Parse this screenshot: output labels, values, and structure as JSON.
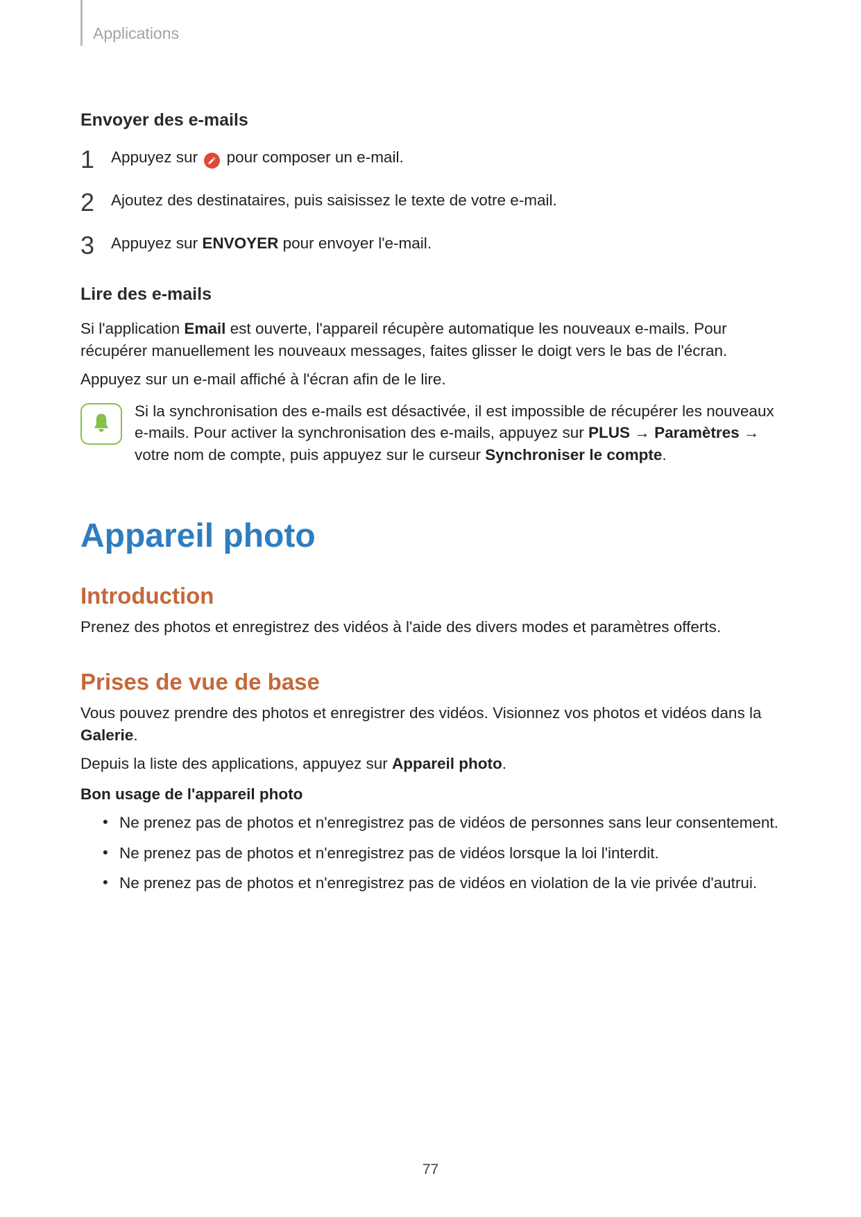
{
  "header": {
    "section": "Applications"
  },
  "email": {
    "send_heading": "Envoyer des e-mails",
    "step1_pre": "Appuyez sur ",
    "step1_post": " pour composer un e-mail.",
    "step2": "Ajoutez des destinataires, puis saisissez le texte de votre e-mail.",
    "step3_pre": "Appuyez sur ",
    "step3_bold": "ENVOYER",
    "step3_post": " pour envoyer l'e-mail.",
    "read_heading": "Lire des e-mails",
    "read_p1_pre": "Si l'application ",
    "read_p1_bold": "Email",
    "read_p1_post": " est ouverte, l'appareil récupère automatique les nouveaux e-mails. Pour récupérer manuellement les nouveaux messages, faites glisser le doigt vers le bas de l'écran.",
    "read_p2": "Appuyez sur un e-mail affiché à l'écran afin de le lire.",
    "note_pre": "Si la synchronisation des e-mails est désactivée, il est impossible de récupérer les nouveaux e-mails. Pour activer la synchronisation des e-mails, appuyez sur ",
    "note_b1": "PLUS",
    "note_arrow": " → ",
    "note_b2": "Paramètres",
    "note_mid": "votre nom de compte, puis appuyez sur le curseur ",
    "note_b3": "Synchroniser le compte",
    "note_end": "."
  },
  "camera": {
    "title": "Appareil photo",
    "intro_heading": "Introduction",
    "intro_text": "Prenez des photos et enregistrez des vidéos à l'aide des divers modes et paramètres offerts.",
    "basic_heading": "Prises de vue de base",
    "basic_p1_pre": "Vous pouvez prendre des photos et enregistrer des vidéos. Visionnez vos photos et vidéos dans la ",
    "basic_p1_bold": "Galerie",
    "basic_p1_post": ".",
    "basic_p2_pre": "Depuis la liste des applications, appuyez sur ",
    "basic_p2_bold": "Appareil photo",
    "basic_p2_post": ".",
    "usage_heading": "Bon usage de l'appareil photo",
    "bullets": [
      "Ne prenez pas de photos et n'enregistrez pas de vidéos de personnes sans leur consentement.",
      "Ne prenez pas de photos et n'enregistrez pas de vidéos lorsque la loi l'interdit.",
      "Ne prenez pas de photos et n'enregistrez pas de vidéos en violation de la vie privée d'autrui."
    ]
  },
  "page_number": "77"
}
